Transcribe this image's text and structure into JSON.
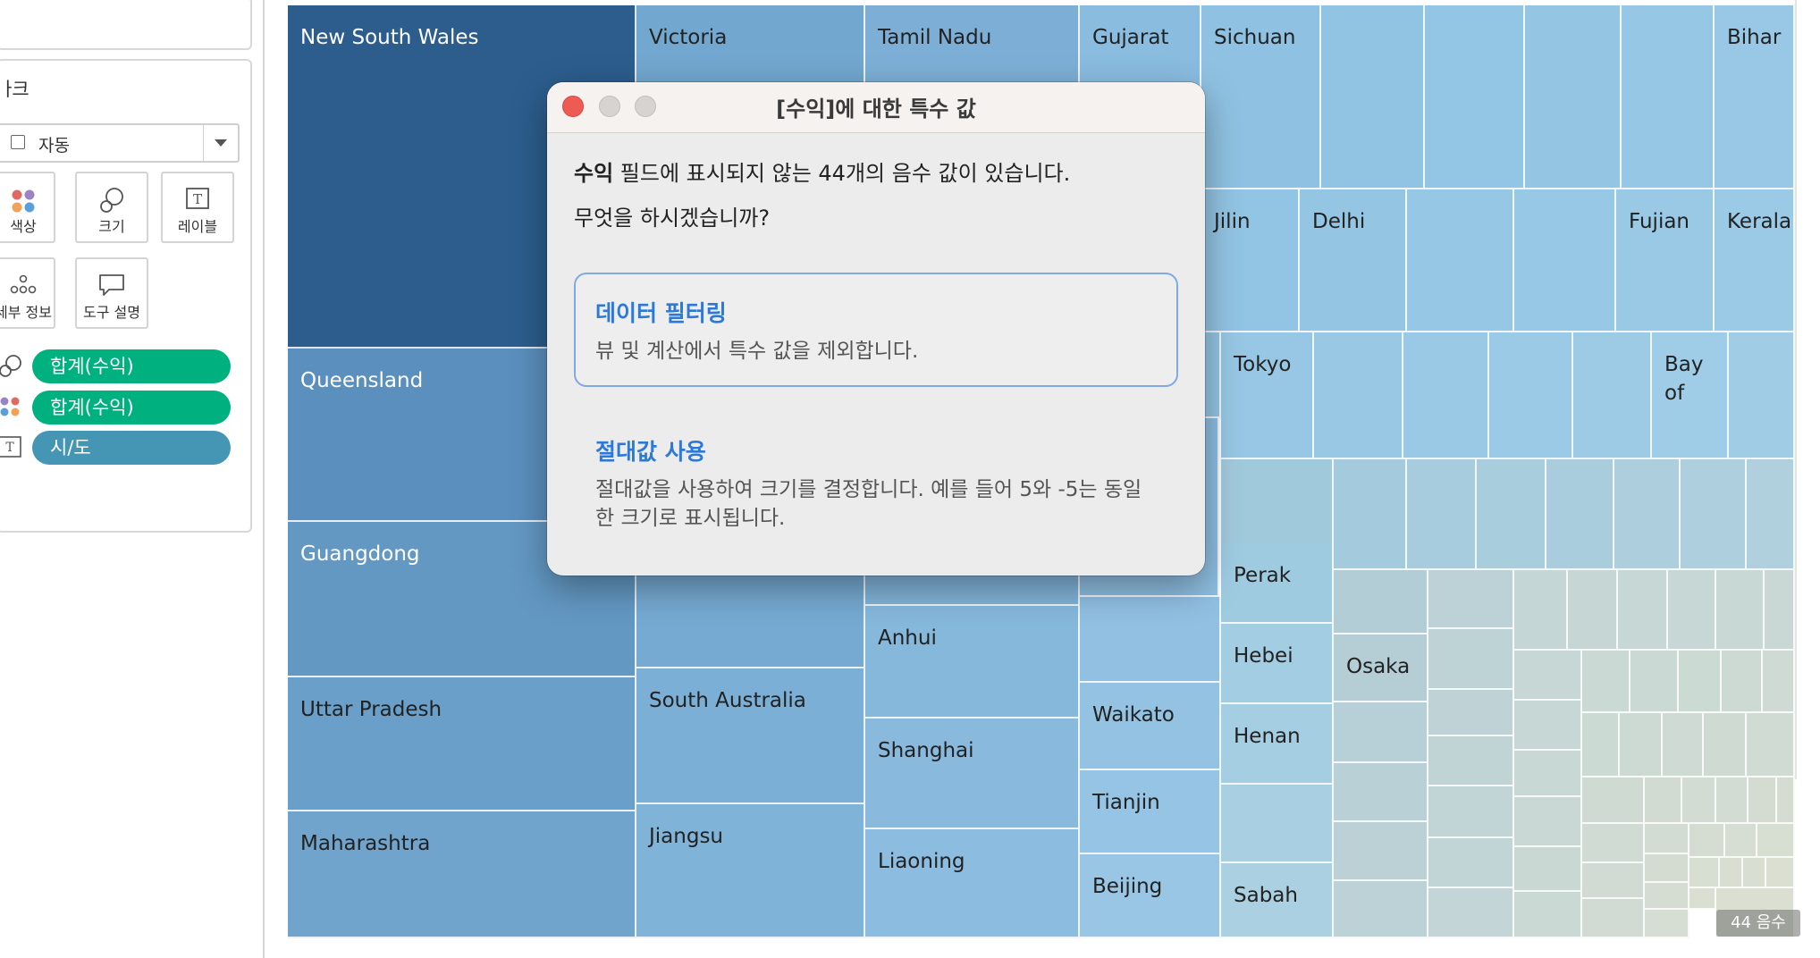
{
  "marks": {
    "title": "마크",
    "mark_type": "자동",
    "buttons": {
      "color": "색상",
      "size": "크기",
      "label": "레이블",
      "detail": "세부 정보",
      "tooltip": "도구 설명"
    },
    "pills": [
      {
        "text": "합계(수익)",
        "kind": "size",
        "color": "#00b180"
      },
      {
        "text": "합계(수익)",
        "kind": "color",
        "color": "#00b180"
      },
      {
        "text": "시/도",
        "kind": "label",
        "color": "#4596b5"
      }
    ]
  },
  "treemap": {
    "labels": {
      "new_south_wales": "New South Wales",
      "victoria": "Victoria",
      "tamil_nadu": "Tamil Nadu",
      "gujarat": "Gujarat",
      "sichuan": "Sichuan",
      "bihar": "Bihar",
      "jilin": "Jilin",
      "delhi": "Delhi",
      "fujian": "Fujian",
      "kerala": "Kerala",
      "queensland": "Queensland",
      "tokyo": "Tokyo",
      "bay_of": "Bay of",
      "guangdong": "Guangdong",
      "perak": "Perak",
      "anhui": "Anhui",
      "hebei": "Hebei",
      "osaka": "Osaka",
      "uttar_pradesh": "Uttar Pradesh",
      "south_australia": "South Australia",
      "waikato": "Waikato",
      "henan": "Henan",
      "shanghai": "Shanghai",
      "tianjin": "Tianjin",
      "maharashtra": "Maharashtra",
      "jiangsu": "Jiangsu",
      "liaoning": "Liaoning",
      "beijing": "Beijing",
      "sabah": "Sabah"
    },
    "negative_badge": "44 음수"
  },
  "dialog": {
    "title": "[수익]에 대한 특수 값",
    "message_field": "수익",
    "message_rest": " 필드에 표시되지 않는 44개의 음수 값이 있습니다.",
    "question": "무엇을 하시겠습니까?",
    "options": [
      {
        "title": "데이터 필터링",
        "desc": "뷰 및 계산에서 특수 값을 제외합니다."
      },
      {
        "title": "절대값 사용",
        "desc": "절대값을 사용하여 크기를 결정합니다. 예를 들어 5와 -5는 동일한 크기로 표시됩니다."
      }
    ]
  }
}
